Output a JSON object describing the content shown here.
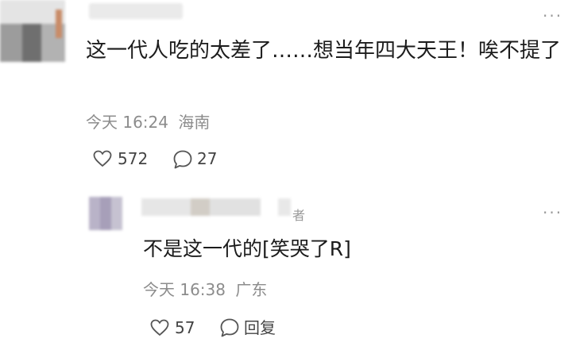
{
  "comment": {
    "text": "这一代人吃的太差了……想当年四大天王！唉不提了",
    "time": "今天 16:24",
    "location": "海南",
    "likes": "572",
    "replies": "27"
  },
  "reply": {
    "author_suffix": "者",
    "text": "不是这一代的[笑哭了R]",
    "time": "今天 16:38",
    "location": "广东",
    "likes": "57",
    "reply_label": "回复"
  },
  "icons": {
    "like": "heart-icon",
    "comment": "speech-bubble-icon",
    "more": "more-dots-icon"
  }
}
